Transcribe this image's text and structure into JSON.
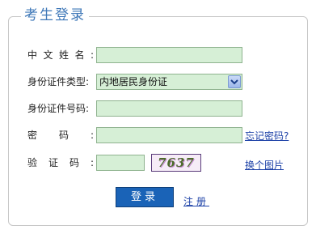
{
  "title": "考生登录",
  "form": {
    "name": {
      "label_chars": [
        "中",
        "文",
        "姓",
        "名",
        ":"
      ],
      "value": ""
    },
    "id_type": {
      "label": "身份证件类型:",
      "selected": "内地居民身份证"
    },
    "id_number": {
      "label": "身份证件号码:",
      "value": ""
    },
    "password": {
      "label_chars": [
        "密",
        "码",
        ":"
      ],
      "value": "",
      "forgot_link": "忘记密码?"
    },
    "captcha": {
      "label_chars": [
        "验",
        "证",
        "码",
        ":"
      ],
      "value": "",
      "image_text": "7637",
      "refresh_link": "换个图片"
    }
  },
  "actions": {
    "login_label": "登录",
    "register_label": "注册"
  },
  "colors": {
    "accent": "#1a63b7",
    "input_bg": "#d6efd6",
    "link": "#1f43a8",
    "title": "#3f78b8"
  }
}
